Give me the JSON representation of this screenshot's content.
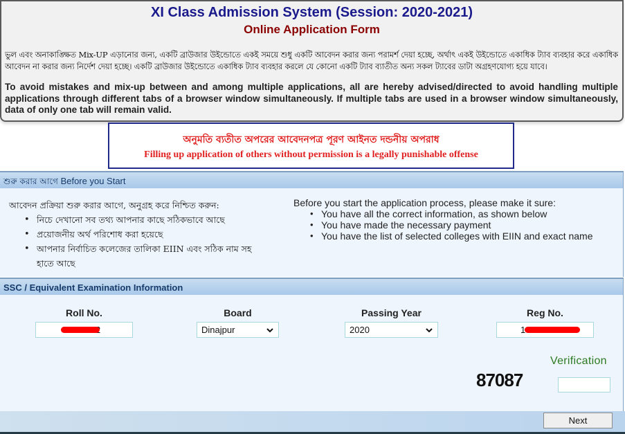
{
  "header": {
    "title": "XI Class Admission System (Session: 2020-2021)",
    "subtitle": "Online Application Form",
    "notice_bn": "ভুল এবং অনাকাঙ্ক্ষিত Mix-UP এড়ানোর জন্য, একটি ব্রাউজার উইন্ডোতে একই সময়ে শুধু একটি আবেদন করার জন্য পরামর্শ দেয়া হচ্ছে, অর্থাৎ একই উইন্ডোতে একাধিক ট্যাব ব্যবহার করে একাধিক আবেদন না করার জন্য নির্দেশ দেয়া হচ্ছে। একটি ব্রাউজার উইন্ডোতে একাধিক ট্যাব ব্যবহার করলে যে কোনো একটি ট্যাব ব্যাতীত অন্য সকল ট্যাবের ডাটা অগ্রহণযোগ্য হয়ে যাবে।",
    "notice_en": "To avoid mistakes and mix-up between and among multiple applications, all are hereby advised/directed to avoid handling multiple applications through different tabs of a browser window simultaneously. If multiple tabs are used in a browser window simultaneously, data of only one tab will remain valid."
  },
  "warning": {
    "bn": "অনুমতি ব্যতীত অপরের আবেদনপত্র পূরণ আইনত দন্ডনীয় অপরাধ",
    "en": "Filling up application of others without permission is a legally punishable offense"
  },
  "before_start": {
    "heading_bn": "শুরু করার আগে",
    "heading_en": "Before you Start",
    "intro_bn": "আবেদন প্রক্রিয়া শুরু করার আগে, অনুগ্রহ করে নিশ্চিত করুন:",
    "items_bn": [
      "নিচে দেখানো সব তথ্য আপনার কাছে সঠিকভাবে আছে",
      "প্রয়োজনীয় অর্থ পরিশোধ করা হয়েছে",
      "আপনার নির্বাচিত কলেজের তালিকা EIIN এবং সঠিক নাম সহ হাতে আছে"
    ],
    "intro_en": "Before you start the application process, please make it sure:",
    "items_en": [
      "You have all the correct information, as shown below",
      "You have made the necessary payment",
      "You have the list of selected colleges with EIIN and exact name"
    ],
    "bullet": "•"
  },
  "ssc": {
    "heading": "SSC / Equivalent Examination Information",
    "roll_label": "Roll No.",
    "roll_value_visible": "2",
    "board_label": "Board",
    "board_value": "Dinajpur",
    "year_label": "Passing Year",
    "year_value": "2020",
    "reg_label": "Reg No.",
    "reg_value_visible": "1",
    "select_chevron": "⌄",
    "verification_label": "Verification",
    "captcha_code": "87087",
    "verification_value": ""
  },
  "footer": {
    "next_label": "Next"
  },
  "colors": {
    "title": "#1a1a8c",
    "subtitle": "#8b0000",
    "warning_text": "#e02020",
    "panel_header": "#a9c9ea",
    "verification": "#2c7a22",
    "redaction": "#ff0000"
  }
}
